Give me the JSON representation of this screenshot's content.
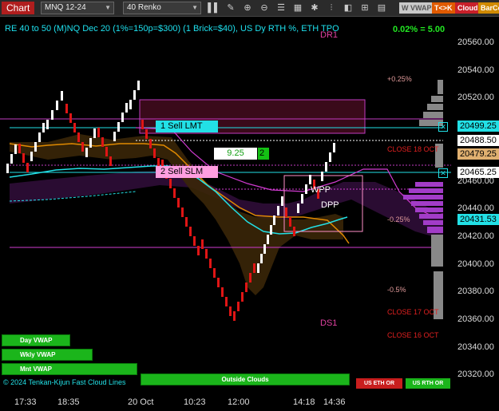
{
  "toolbar": {
    "chart_label": "Chart",
    "instrument": "MNQ 12-24",
    "bar_type": "40 Renko",
    "vwap_label": "W VWAP",
    "tk_label": "T<>K",
    "cloud_label": "Cloud",
    "barco_label": "BarCo",
    "icons": [
      "bar-chart-icon",
      "pencil-icon",
      "zoom-in-icon",
      "zoom-out-icon",
      "list-icon",
      "grid-icon",
      "settings-icon",
      "chart-type-icon",
      "indicator-icon",
      "align-icon",
      "grid-lines-icon"
    ]
  },
  "chart": {
    "title": "RE 40 to 50 (M)NQ Dec 20 (1%=150p=$300) (1 Brick=$40), US Dy RTH %, ETH TPO",
    "percent_readout": "0.02% = 5.00",
    "labels": {
      "dr1": "DR1",
      "ds1": "DS1",
      "wpp": "WPP",
      "dpp": "DPP",
      "p025": "+0.25%",
      "m025": "-0.25%",
      "m05": "-0.5%",
      "close18": "CLOSE 18 OCT",
      "close17": "CLOSE 17 OCT",
      "close16": "CLOSE 16 OCT"
    },
    "orders": {
      "sell_lmt": "1 Sell LMT",
      "sell_slm": "2 Sell SLM",
      "ticks_value": "9.25",
      "ticks_count": "2"
    },
    "price_labels": {
      "p1": "20499.25",
      "p2": "20488.50",
      "p3": "20479.25",
      "p4": "20465.25",
      "p5": "20431.53"
    },
    "y_ticks": [
      "20560.00",
      "20540.00",
      "20520.00",
      "20500.00",
      "20480.00",
      "20460.00",
      "20440.00",
      "20420.00",
      "20400.00",
      "20380.00",
      "20360.00",
      "20340.00",
      "20320.00"
    ],
    "x_ticks": [
      "17:33",
      "18:35",
      "20 Oct",
      "10:23",
      "12:00",
      "14:18",
      "14:36"
    ],
    "buttons": {
      "day_vwap": "Day VWAP",
      "wkly_vwap": "Wkly VWAP",
      "mnt_vwap": "Mnt VWAP",
      "outside_clouds": "Outside Clouds",
      "us_eth": "US ETH OR",
      "us_rth": "US RTH OR"
    },
    "copyright": "© 2024 Tenkan-Kijun Fast Cloud Lines",
    "colors": {
      "up": "#ffffff",
      "down": "#e01515",
      "cyan": "#22e0e6",
      "orange": "#e08a00",
      "magenta": "#d13bd1",
      "green": "#1bb51b"
    }
  }
}
